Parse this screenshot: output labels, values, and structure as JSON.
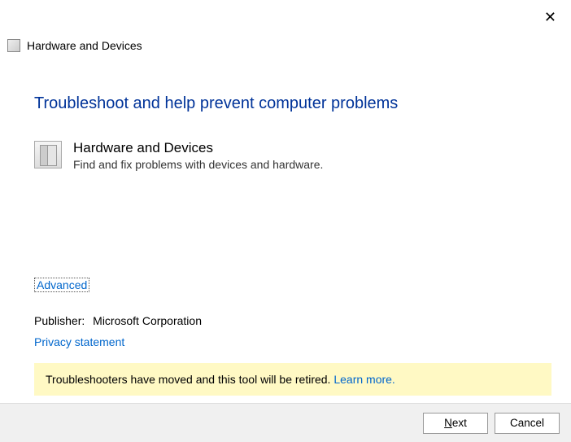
{
  "header": {
    "title": "Hardware and Devices"
  },
  "main": {
    "heading": "Troubleshoot and help prevent computer problems",
    "device": {
      "title": "Hardware and Devices",
      "subtitle": "Find and fix problems with devices and hardware."
    },
    "advanced_label": "Advanced",
    "publisher_label": "Publisher:",
    "publisher_value": "Microsoft Corporation",
    "privacy_label": "Privacy statement",
    "banner": {
      "text": "Troubleshooters have moved and this tool will be retired. ",
      "link": "Learn more."
    }
  },
  "footer": {
    "next_prefix": "N",
    "next_rest": "ext",
    "cancel": "Cancel"
  }
}
